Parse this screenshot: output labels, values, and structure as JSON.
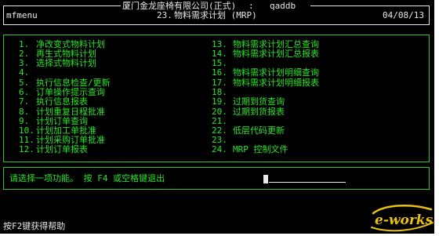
{
  "header": {
    "company": "厦门金龙座椅有限公司(正式)",
    "separator": ":",
    "user": "qaddb",
    "program": "mfmenu",
    "menu_code": "23.",
    "menu_title": "物料需求计划 (MRP)",
    "date": "04/08/13"
  },
  "menu": {
    "left": [
      {
        "num": "1.",
        "label": "净改变式物料计划"
      },
      {
        "num": "2.",
        "label": "再生式物料计划"
      },
      {
        "num": "3.",
        "label": "选择式物料计划"
      },
      {
        "num": "4.",
        "label": ""
      },
      {
        "num": "5.",
        "label": "执行信息检查/更新"
      },
      {
        "num": "6.",
        "label": "订单操作提示查询"
      },
      {
        "num": "7.",
        "label": "执行信息报表"
      },
      {
        "num": "8.",
        "label": "计划重复日程批准"
      },
      {
        "num": "9.",
        "label": "计划订单查询"
      },
      {
        "num": "10.",
        "label": "计划加工单批准"
      },
      {
        "num": "11.",
        "label": "计划采购订单批准"
      },
      {
        "num": "12.",
        "label": "计划订单报表"
      }
    ],
    "right": [
      {
        "num": "13.",
        "label": "物料需求计划汇总查询"
      },
      {
        "num": "14.",
        "label": "物料需求计划汇总报表"
      },
      {
        "num": "15.",
        "label": ""
      },
      {
        "num": "16.",
        "label": "物料需求计划明细查询"
      },
      {
        "num": "17.",
        "label": "物料需求计划明细报表"
      },
      {
        "num": "18.",
        "label": ""
      },
      {
        "num": "19.",
        "label": "过期到货查询"
      },
      {
        "num": "20.",
        "label": "过期到货报表"
      },
      {
        "num": "21.",
        "label": ""
      },
      {
        "num": "22.",
        "label": "低层代码更新"
      },
      {
        "num": "23.",
        "label": ""
      },
      {
        "num": "24.",
        "label": "MRP 控制文件"
      }
    ]
  },
  "prompt": {
    "text": "请选择一项功能。 按 F4 或空格键退出",
    "value": ""
  },
  "status": {
    "help_text": "按F2键获得帮助"
  },
  "watermark": {
    "brand": "e-works"
  },
  "colors": {
    "background": "#000000",
    "menu_text": "#28e528",
    "header_text": "#e8e8e8",
    "box_border": "#2fbf2f",
    "watermark": "#e8c20f"
  }
}
